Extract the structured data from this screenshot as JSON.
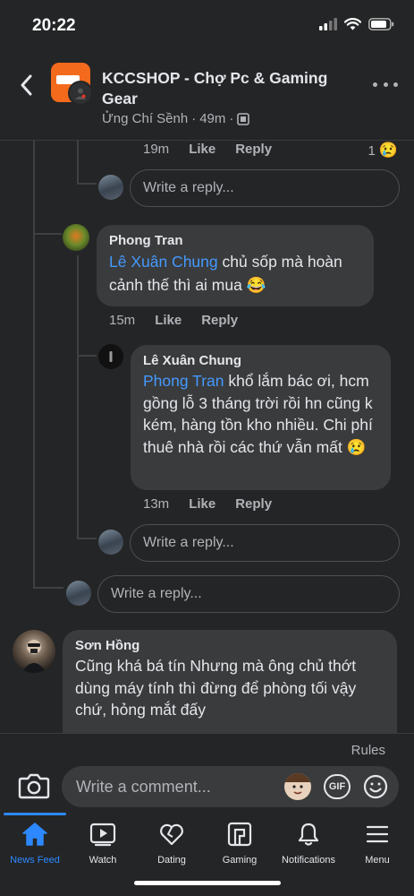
{
  "status_bar": {
    "time": "20:22"
  },
  "header": {
    "title": "KCCSHOP - Chợ Pc & Gaming Gear",
    "author": "Ửng Chí Sềnh",
    "time": "49m"
  },
  "top_comment_tail": {
    "time": "19m",
    "like": "Like",
    "reply": "Reply",
    "reaction_count": "1"
  },
  "reply_placeholder": "Write a reply...",
  "comments": [
    {
      "name": "Phong Tran",
      "mention": "Lê Xuân Chung",
      "text": " chủ sốp mà hoàn cảnh thế thì ai mua 😂",
      "time": "15m",
      "like": "Like",
      "reply": "Reply"
    },
    {
      "name": "Lê Xuân Chung",
      "mention": "Phong Tran",
      "text": "  khổ lắm bác ơi, hcm gồng lỗ 3 tháng trời rồi hn cũng k kém, hàng tồn kho nhiều. Chi phí thuê nhà rồi các thứ vẫn mất 😢",
      "time": "13m",
      "like": "Like",
      "reply": "Reply"
    },
    {
      "name": "Sơn Hồng",
      "text": "Cũng khá bá tín Nhưng mà ông chủ thớt dùng máy tính thì đừng để phòng tối vậy chứ, hỏng mắt đấy"
    }
  ],
  "composer": {
    "rules": "Rules",
    "placeholder": "Write a comment...",
    "gif": "GIF"
  },
  "tabs": [
    {
      "label": "News Feed",
      "icon": "home-icon",
      "active": true
    },
    {
      "label": "Watch",
      "icon": "watch-icon"
    },
    {
      "label": "Dating",
      "icon": "dating-heart-icon"
    },
    {
      "label": "Gaming",
      "icon": "gaming-icon"
    },
    {
      "label": "Notifications",
      "icon": "bell-icon"
    },
    {
      "label": "Menu",
      "icon": "menu-icon"
    }
  ],
  "colors": {
    "background": "#242526",
    "bubble": "#3a3b3c",
    "mention": "#4599ff",
    "accent": "#2d88ff",
    "page_avatar": "#f46a1c"
  }
}
